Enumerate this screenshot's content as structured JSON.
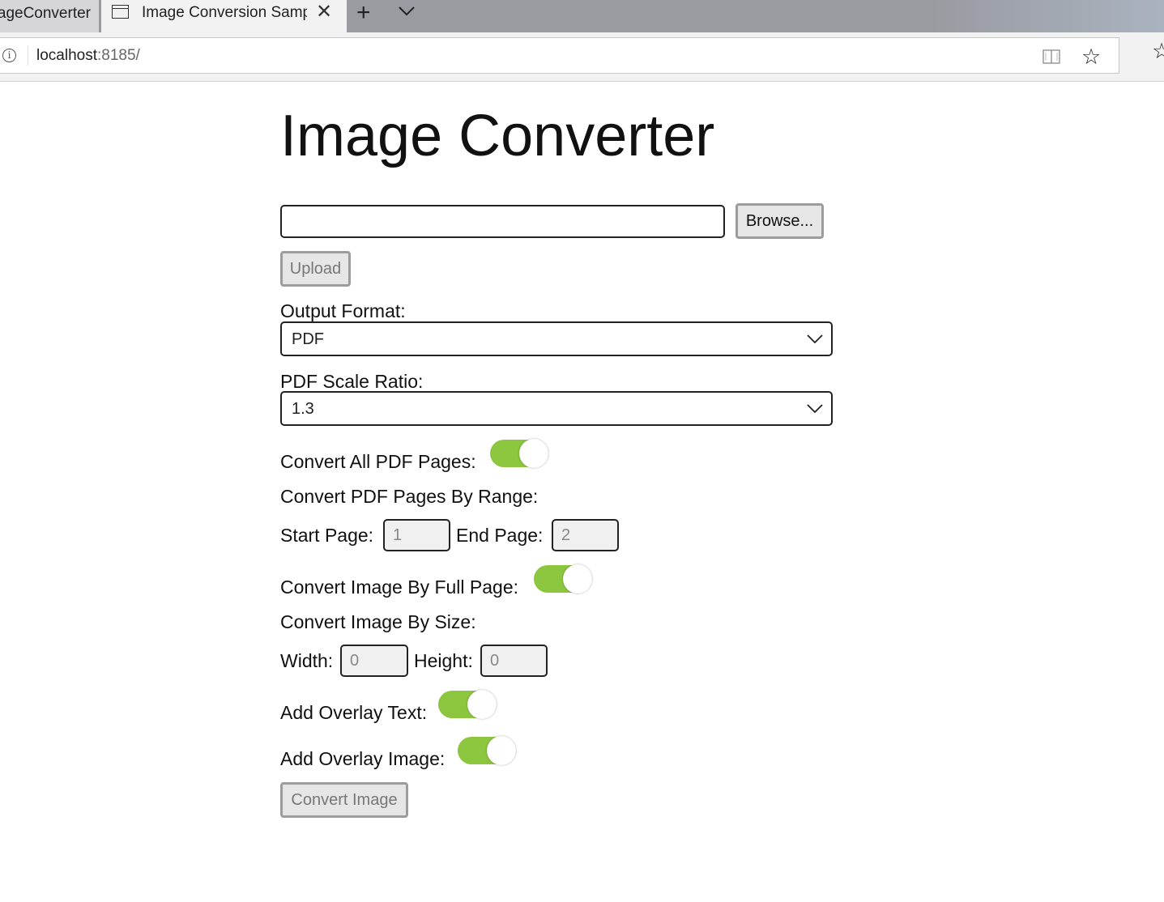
{
  "browser": {
    "inactive_tab_title": "ImageConverter",
    "active_tab_title": "Image Conversion Samp",
    "url_host": "localhost",
    "url_rest": ":8185/"
  },
  "page": {
    "title": "Image Converter",
    "file_input_value": "",
    "browse_label": "Browse...",
    "upload_label": "Upload",
    "output_format_label": "Output Format:",
    "output_format_value": "PDF",
    "scale_ratio_label": "PDF Scale Ratio:",
    "scale_ratio_value": "1.3",
    "convert_all_label": "Convert All PDF Pages:",
    "convert_all_on": true,
    "by_range_label": "Convert PDF Pages By Range:",
    "start_page_label": "Start Page:",
    "start_page_value": "1",
    "end_page_label": "End Page:",
    "end_page_value": "2",
    "full_page_label": "Convert Image By Full Page:",
    "full_page_on": true,
    "by_size_label": "Convert Image By Size:",
    "width_label": "Width:",
    "width_value": "0",
    "height_label": "Height:",
    "height_value": "0",
    "overlay_text_label": "Add Overlay Text:",
    "overlay_text_on": true,
    "overlay_image_label": "Add Overlay Image:",
    "overlay_image_on": true,
    "convert_button_label": "Convert Image"
  },
  "colors": {
    "toggle_on": "#8cc63f",
    "button_bg": "#e6e6e6",
    "button_border": "#9c9c9c"
  }
}
